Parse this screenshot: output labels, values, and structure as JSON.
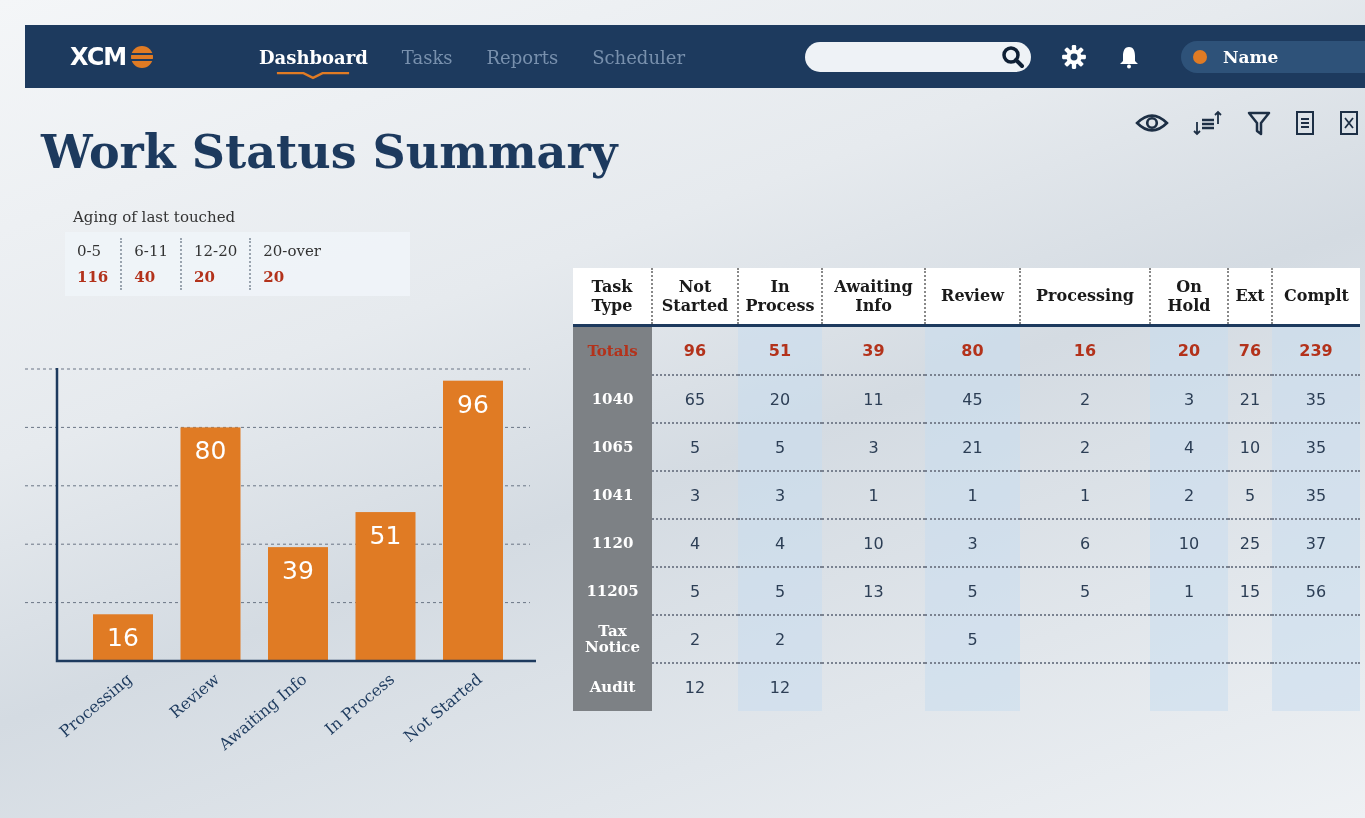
{
  "nav": {
    "logo": "XCM",
    "tabs": [
      {
        "label": "Dashboard",
        "selected": true
      },
      {
        "label": "Tasks",
        "selected": false
      },
      {
        "label": "Reports",
        "selected": false
      },
      {
        "label": "Scheduler",
        "selected": false
      }
    ],
    "user": {
      "name": "Name"
    }
  },
  "title": "Work Status Summary",
  "aging": {
    "caption": "Aging of last touched",
    "buckets": [
      {
        "label": "0-5",
        "count": "116"
      },
      {
        "label": "6-11",
        "count": "40"
      },
      {
        "label": "12-20",
        "count": "20"
      },
      {
        "label": "20-over",
        "count": "20"
      }
    ]
  },
  "chart": {
    "chart_data": {
      "type": "bar",
      "categories": [
        "Processing",
        "Review",
        "Awaiting Info",
        "In Process",
        "Not Started"
      ],
      "values": [
        16,
        80,
        39,
        51,
        96
      ],
      "ylim": [
        0,
        100
      ],
      "data_labels": true
    }
  },
  "table": {
    "columns": [
      "Task Type",
      "Not Started",
      "In Process",
      "Awaiting Info",
      "Review",
      "Processing",
      "On Hold",
      "Ext",
      "Complt"
    ],
    "rows": [
      {
        "kind": "totals",
        "cells": [
          "Totals",
          "96",
          "51",
          "39",
          "80",
          "16",
          "20",
          "76",
          "239"
        ]
      },
      {
        "kind": "data",
        "cells": [
          "1040",
          "65",
          "20",
          "11",
          "45",
          "2",
          "3",
          "21",
          "35"
        ]
      },
      {
        "kind": "data",
        "cells": [
          "1065",
          "5",
          "5",
          "3",
          "21",
          "2",
          "4",
          "10",
          "35"
        ]
      },
      {
        "kind": "data",
        "cells": [
          "1041",
          "3",
          "3",
          "1",
          "1",
          "1",
          "2",
          "5",
          "35"
        ]
      },
      {
        "kind": "data",
        "cells": [
          "1120",
          "4",
          "4",
          "10",
          "3",
          "6",
          "10",
          "25",
          "37"
        ]
      },
      {
        "kind": "data",
        "cells": [
          "11205",
          "5",
          "5",
          "13",
          "5",
          "5",
          "1",
          "15",
          "56"
        ]
      },
      {
        "kind": "data",
        "cells": [
          "Tax Notice",
          "2",
          "2",
          null,
          "5",
          null,
          null,
          null,
          null
        ]
      },
      {
        "kind": "data",
        "cells": [
          "Audit",
          "12",
          "12",
          null,
          null,
          null,
          null,
          null,
          null
        ]
      }
    ]
  }
}
